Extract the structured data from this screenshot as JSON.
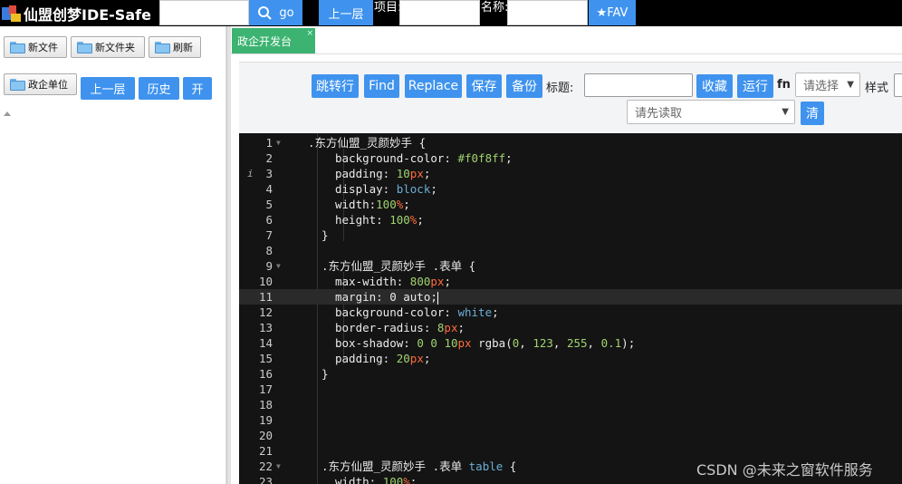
{
  "topbar": {
    "app_title": "仙盟创梦IDE-Safe",
    "search_value": "",
    "go_label": "go",
    "up_label": "上一层",
    "project_label": "项目:",
    "project_value": "",
    "name_label": "名称:",
    "name_value": "",
    "fav_label": "★FAV"
  },
  "left": {
    "new_file": "新文件",
    "new_folder": "新文件夹",
    "refresh": "刷新",
    "unit": "政企单位",
    "up": "上一层",
    "history": "历史",
    "open": "开"
  },
  "tabs": [
    {
      "label": "政企开发台",
      "close": "×"
    }
  ],
  "toolbar": {
    "jump": "跳转行",
    "find": "Find",
    "replace": "Replace",
    "save": "保存",
    "backup": "备份",
    "title_label": "标题:",
    "title_value": "",
    "collect": "收藏",
    "run": "运行",
    "fn_label": "fn",
    "fn_select": "请选择",
    "style_label": "样式",
    "read_select": "请先读取",
    "clear": "清"
  },
  "editor": {
    "active_line": 11,
    "info_line": 3,
    "info_marker": "i",
    "lines": [
      {
        "n": "1",
        "fold": true,
        "text": ".东方仙盟_灵颜妙手 {"
      },
      {
        "n": "2",
        "text": "background-color: #f0f8ff;"
      },
      {
        "n": "3",
        "text": "padding: 10px;"
      },
      {
        "n": "4",
        "text": "display: block;"
      },
      {
        "n": "5",
        "text": "width:100%;"
      },
      {
        "n": "6",
        "text": "height: 100%;"
      },
      {
        "n": "7",
        "text": "}"
      },
      {
        "n": "8",
        "text": ""
      },
      {
        "n": "9",
        "fold": true,
        "text": ".东方仙盟_灵颜妙手 .表单 {"
      },
      {
        "n": "10",
        "text": "max-width: 800px;"
      },
      {
        "n": "11",
        "text": "margin: 0 auto;"
      },
      {
        "n": "12",
        "text": "background-color: white;"
      },
      {
        "n": "13",
        "text": "border-radius: 8px;"
      },
      {
        "n": "14",
        "text": "box-shadow: 0 0 10px rgba(0, 123, 255, 0.1);"
      },
      {
        "n": "15",
        "text": "padding: 20px;"
      },
      {
        "n": "16",
        "text": "}"
      },
      {
        "n": "17",
        "text": ""
      },
      {
        "n": "18",
        "text": ""
      },
      {
        "n": "19",
        "text": ""
      },
      {
        "n": "20",
        "text": ""
      },
      {
        "n": "21",
        "text": ""
      },
      {
        "n": "22",
        "fold": true,
        "text": ".东方仙盟_灵颜妙手 .表单 table {"
      },
      {
        "n": "23",
        "text": "width: 100%;"
      }
    ]
  },
  "watermark": "CSDN @未来之窗软件服务"
}
